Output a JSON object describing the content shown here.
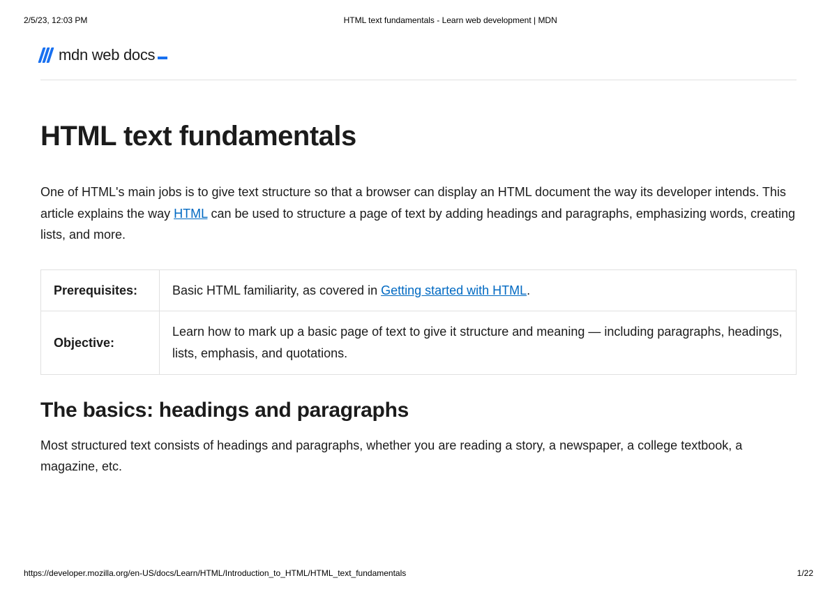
{
  "print": {
    "timestamp": "2/5/23, 12:03 PM",
    "doc_title": "HTML text fundamentals - Learn web development | MDN",
    "url": "https://developer.mozilla.org/en-US/docs/Learn/HTML/Introduction_to_HTML/HTML_text_fundamentals",
    "page_indicator": "1/22"
  },
  "logo": {
    "text": "mdn web docs"
  },
  "article": {
    "title": "HTML text fundamentals",
    "intro_before_link": "One of HTML's main jobs is to give text structure so that a browser can display an HTML document the way its developer intends. This article explains the way ",
    "intro_link": "HTML",
    "intro_after_link": " can be used to structure a page of text by adding headings and paragraphs, emphasizing words, creating lists, and more.",
    "prereq_label": "Prerequisites:",
    "prereq_before_link": "Basic HTML familiarity, as covered in ",
    "prereq_link": "Getting started with HTML",
    "prereq_after_link": ".",
    "objective_label": "Objective:",
    "objective_text": "Learn how to mark up a basic page of text to give it structure and meaning — including paragraphs, headings, lists, emphasis, and quotations.",
    "section_heading": "The basics: headings and paragraphs",
    "section_body": "Most structured text consists of headings and paragraphs, whether you are reading a story, a newspaper, a college textbook, a magazine, etc."
  }
}
